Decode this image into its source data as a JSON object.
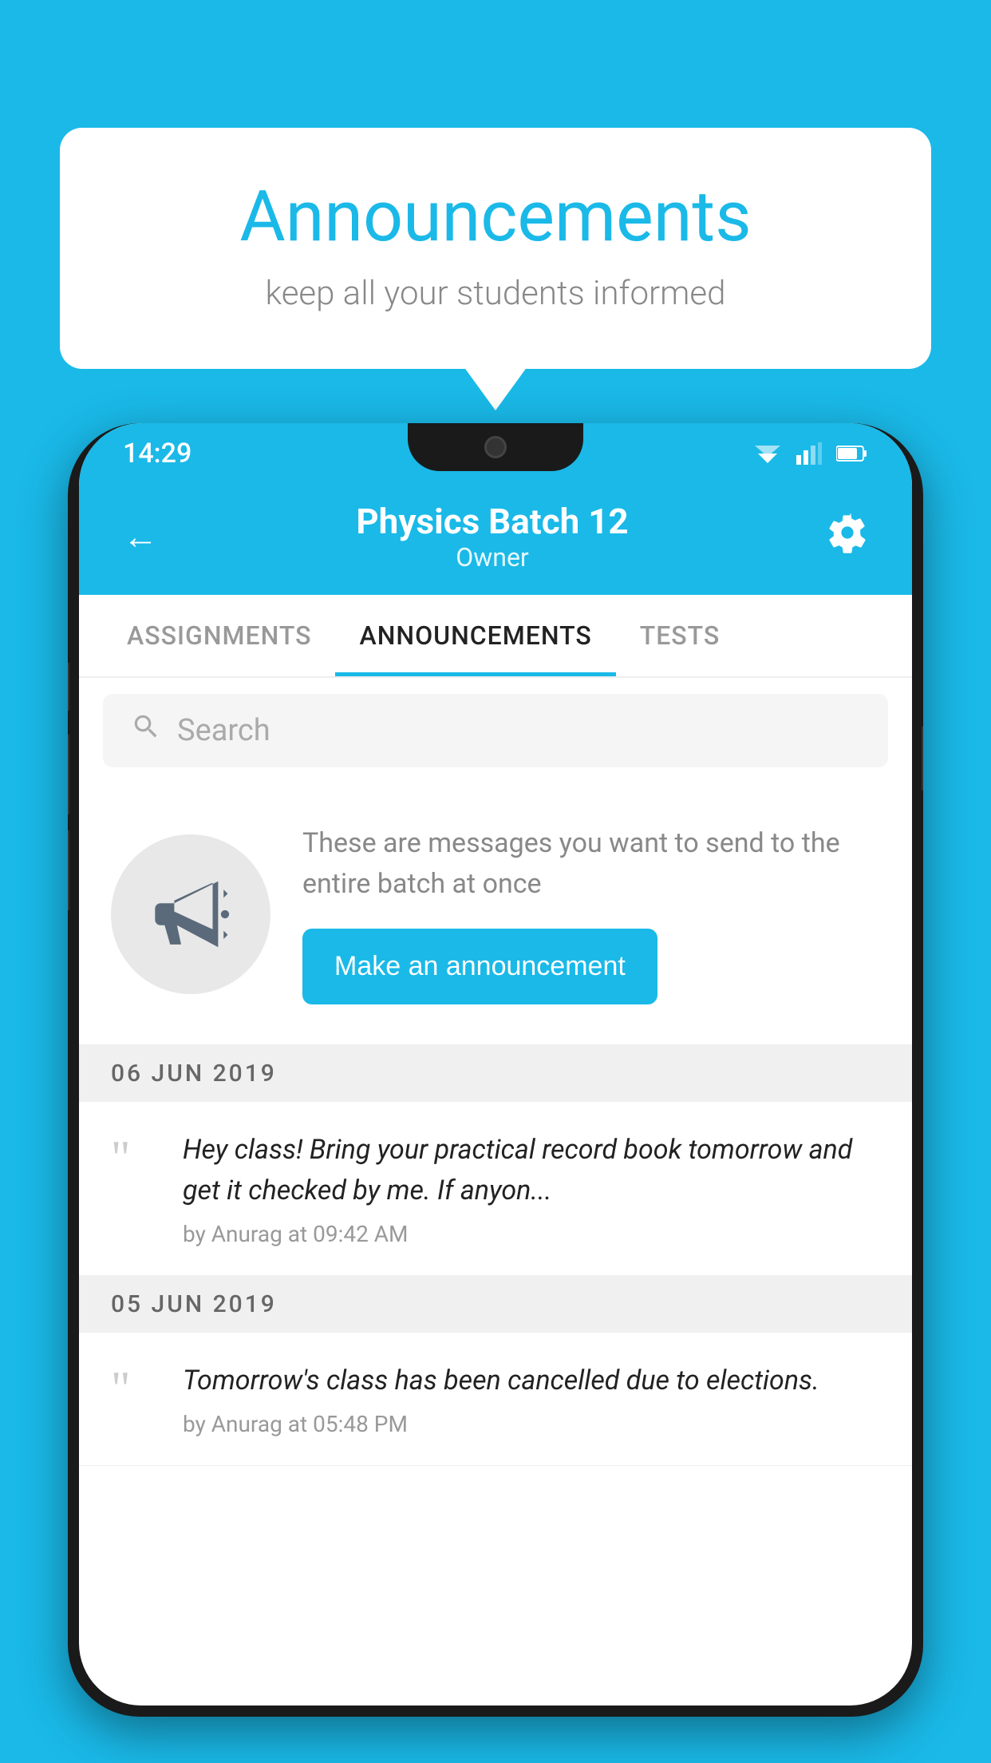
{
  "background_color": "#1ab9e8",
  "speech_bubble": {
    "title": "Announcements",
    "subtitle": "keep all your students informed"
  },
  "phone": {
    "status_bar": {
      "time": "14:29"
    },
    "header": {
      "title": "Physics Batch 12",
      "subtitle": "Owner",
      "back_label": "←",
      "settings_label": "⚙"
    },
    "tabs": [
      {
        "label": "ASSIGNMENTS",
        "active": false
      },
      {
        "label": "ANNOUNCEMENTS",
        "active": true
      },
      {
        "label": "TESTS",
        "active": false
      }
    ],
    "search": {
      "placeholder": "Search"
    },
    "cta": {
      "description": "These are messages you want to send to the entire batch at once",
      "button_label": "Make an announcement"
    },
    "announcements": [
      {
        "date": "06  JUN  2019",
        "text": "Hey class! Bring your practical record book tomorrow and get it checked by me. If anyon...",
        "meta": "by Anurag at 09:42 AM"
      },
      {
        "date": "05  JUN  2019",
        "text": "Tomorrow's class has been cancelled due to elections.",
        "meta": "by Anurag at 05:48 PM"
      }
    ]
  }
}
